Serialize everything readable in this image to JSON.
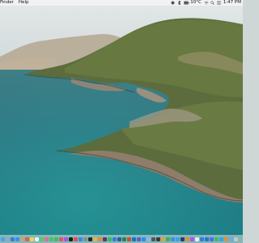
{
  "menubar": {
    "app_menu": "Finder",
    "help_menu": "Help",
    "temperature": "10°C",
    "clock": "1:47 PM"
  },
  "dock": {
    "icons": [
      {
        "name": "finder",
        "color": "#4aa3f0"
      },
      {
        "name": "launchpad",
        "color": "#9aa7b6"
      },
      {
        "name": "safari",
        "color": "#2f7fe3"
      },
      {
        "name": "mail",
        "color": "#3b8ef2"
      },
      {
        "name": "contacts",
        "color": "#c8a56b"
      },
      {
        "name": "calendar",
        "color": "#f05a4a"
      },
      {
        "name": "notes",
        "color": "#f5d64a"
      },
      {
        "name": "reminders",
        "color": "#f2f2f2"
      },
      {
        "name": "maps",
        "color": "#5cc86a"
      },
      {
        "name": "photos",
        "color": "#e96a8d"
      },
      {
        "name": "messages",
        "color": "#48c65a"
      },
      {
        "name": "facetime",
        "color": "#3fbf57"
      },
      {
        "name": "music",
        "color": "#f24a6a"
      },
      {
        "name": "podcasts",
        "color": "#a05ae0"
      },
      {
        "name": "tv",
        "color": "#1b1b1b"
      },
      {
        "name": "news",
        "color": "#f04a4a"
      },
      {
        "name": "app-store",
        "color": "#2f8af2"
      },
      {
        "name": "system-preferences",
        "color": "#8c8c8c"
      },
      {
        "name": "terminal",
        "color": "#2a2a2a"
      },
      {
        "name": "chrome",
        "color": "#e6b83a"
      },
      {
        "name": "firefox",
        "color": "#f08a2a"
      },
      {
        "name": "slack",
        "color": "#6b2e6b"
      },
      {
        "name": "spotify",
        "color": "#2fbf5f"
      },
      {
        "name": "vscode",
        "color": "#2f7fd6"
      },
      {
        "name": "word",
        "color": "#2b5aa8"
      },
      {
        "name": "excel",
        "color": "#21874b"
      },
      {
        "name": "powerpoint",
        "color": "#d24c2a"
      },
      {
        "name": "outlook",
        "color": "#1a6fd0"
      },
      {
        "name": "teams",
        "color": "#5b5fc7"
      },
      {
        "name": "zoom",
        "color": "#2d8cff"
      },
      {
        "name": "preview",
        "color": "#8fb6e6"
      },
      {
        "name": "calculator",
        "color": "#555555"
      },
      {
        "name": "activity-monitor",
        "color": "#3a3a3a"
      },
      {
        "name": "pages",
        "color": "#f39a3a"
      },
      {
        "name": "numbers",
        "color": "#3ab54a"
      },
      {
        "name": "keynote",
        "color": "#3a8ef0"
      },
      {
        "name": "xcode",
        "color": "#3aa0f0"
      },
      {
        "name": "photoshop",
        "color": "#2a3a7a"
      },
      {
        "name": "illustrator",
        "color": "#f08a2a"
      },
      {
        "name": "figma",
        "color": "#a25af0"
      },
      {
        "name": "notion",
        "color": "#eeeeee"
      },
      {
        "name": "dropbox",
        "color": "#2f7fe3"
      },
      {
        "name": "1password",
        "color": "#2f6fd6"
      },
      {
        "name": "discord",
        "color": "#5865f2"
      },
      {
        "name": "whatsapp",
        "color": "#3ac25a"
      },
      {
        "name": "telegram",
        "color": "#3aa3e0"
      },
      {
        "name": "vlc",
        "color": "#f08a2a"
      },
      {
        "name": "folder",
        "color": "#6aaee8"
      },
      {
        "name": "trash",
        "color": "#c8c8c8"
      }
    ]
  }
}
